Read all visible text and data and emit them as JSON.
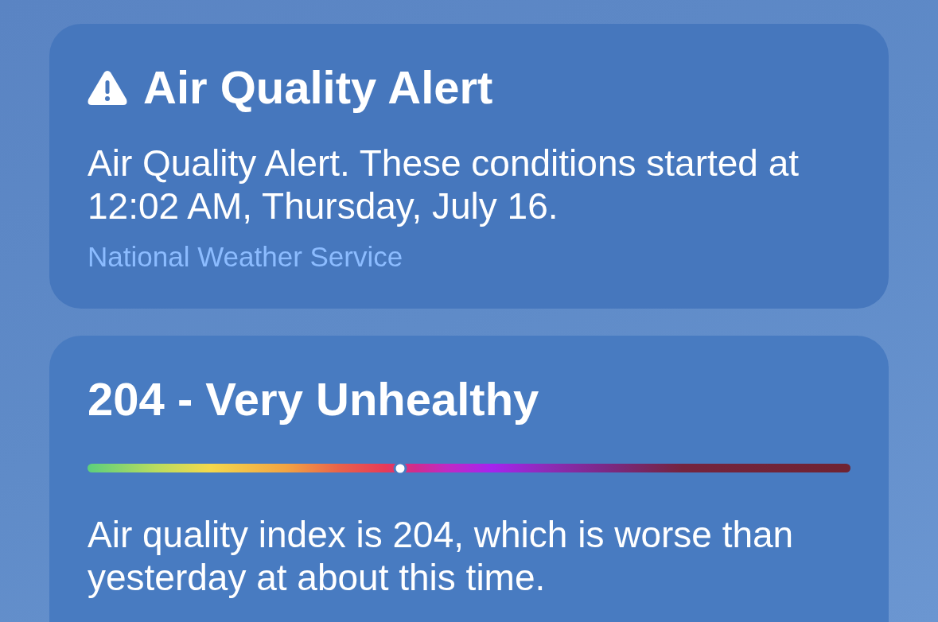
{
  "alert": {
    "title": "Air Quality Alert",
    "description": "Air Quality Alert. These conditions started at 12:02 AM, Thursday, July 16.",
    "source": "National Weather Service"
  },
  "air_quality": {
    "title": "204 - Very Unhealthy",
    "scale": {
      "level": 0.41
    },
    "summary": "Air quality index is 204, which is worse than yesterday at about this time."
  }
}
